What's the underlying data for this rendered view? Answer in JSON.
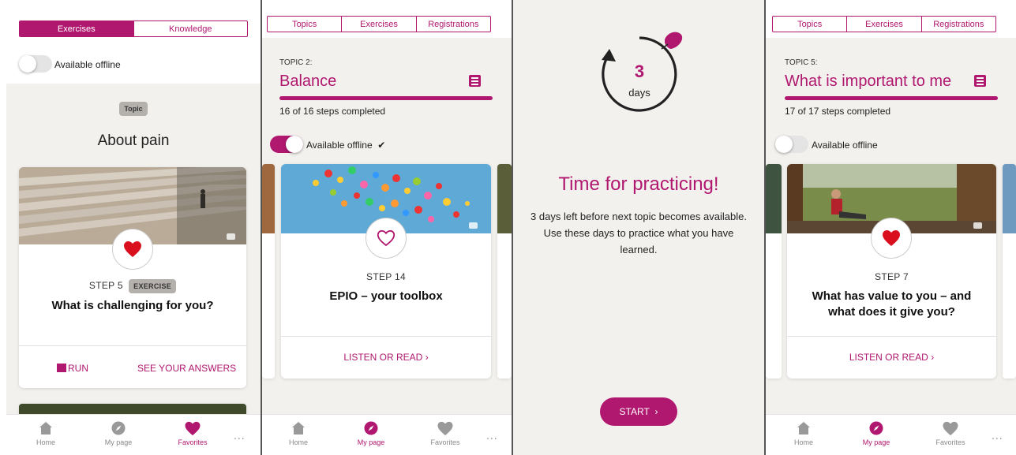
{
  "colors": {
    "accent": "#b0176f",
    "background": "#f3f1ee",
    "tab_inactive": "#888888"
  },
  "screen1": {
    "tabs": [
      "Exercises",
      "Knowledge"
    ],
    "offline_label": "Available offline",
    "badge": "Topic",
    "heading": "About pain",
    "card": {
      "step": "STEP 5",
      "step_badge": "EXERCISE",
      "title": "What is challenging for you?",
      "action_run": "RUN",
      "action_answers": "SEE YOUR ANSWERS",
      "icon": "heart-filled-icon"
    },
    "nav": {
      "home": "Home",
      "mypage": "My page",
      "favorites": "Favorites",
      "more": "..."
    }
  },
  "screen2": {
    "tabs": [
      "Topics",
      "Exercises",
      "Registrations"
    ],
    "topic_label": "TOPIC 2:",
    "topic_title": "Balance",
    "progress_text": "16 of 16 steps completed",
    "progress": 1.0,
    "offline_label": "Available offline",
    "offline_check": "✔",
    "card": {
      "step": "STEP 14",
      "title": "EPIO – your toolbox",
      "action": "LISTEN OR READ",
      "icon": "heart-outline-icon"
    },
    "nav": {
      "home": "Home",
      "mypage": "My page",
      "favorites": "Favorites",
      "more": "..."
    }
  },
  "screen3": {
    "countdown_number": "3",
    "countdown_unit": "days",
    "heading": "Time for practicing!",
    "body": "3 days left before next topic becomes available. Use these days to practice what you have learned.",
    "button": "START"
  },
  "screen4": {
    "tabs": [
      "Topics",
      "Exercises",
      "Registrations"
    ],
    "topic_label": "TOPIC 5:",
    "topic_title": "What is important to me",
    "progress_text": "17 of 17 steps completed",
    "progress": 1.0,
    "offline_label": "Available offline",
    "card": {
      "step": "STEP 7",
      "title_line1": "What has value to you – and",
      "title_line2": "what does it give you?",
      "action": "LISTEN OR READ",
      "icon": "heart-filled-icon"
    },
    "nav": {
      "home": "Home",
      "mypage": "My page",
      "favorites": "Favorites",
      "more": "..."
    }
  }
}
